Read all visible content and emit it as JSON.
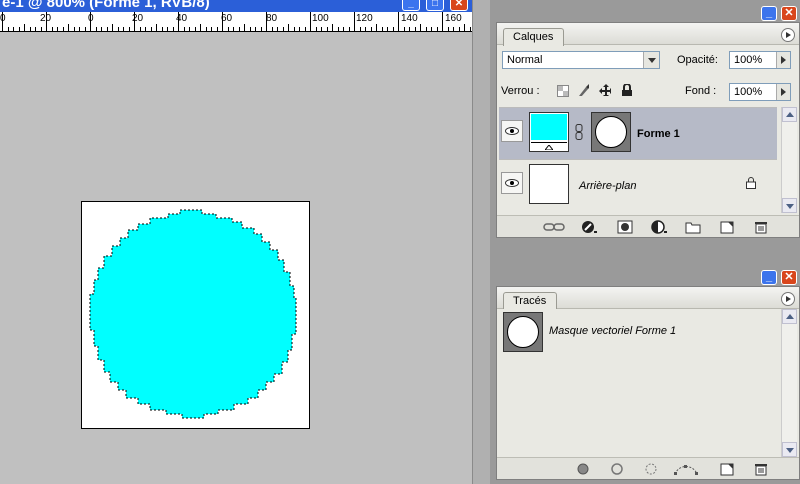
{
  "document": {
    "title": "e-1 @ 800% (Forme 1, RVB/8)",
    "ruler_labels": [
      "0",
      "20",
      "0",
      "20",
      "40",
      "60",
      "80",
      "100",
      "120",
      "140",
      "160"
    ],
    "shape_color": "#00ffff"
  },
  "layers_palette": {
    "tab": "Calques",
    "blend_mode": "Normal",
    "opacity_label": "Opacité:",
    "opacity_value": "100%",
    "lock_label": "Verrou :",
    "fill_label": "Fond :",
    "fill_value": "100%",
    "layers": [
      {
        "name": "Forme 1",
        "selected": true
      },
      {
        "name": "Arrière-plan",
        "selected": false
      }
    ]
  },
  "paths_palette": {
    "tab": "Tracés",
    "paths": [
      {
        "name": "Masque vectoriel Forme 1"
      }
    ]
  },
  "colors": {
    "selection": "#b6bac7",
    "xp_blue": "#3c74ec",
    "xp_red": "#d9461c"
  }
}
